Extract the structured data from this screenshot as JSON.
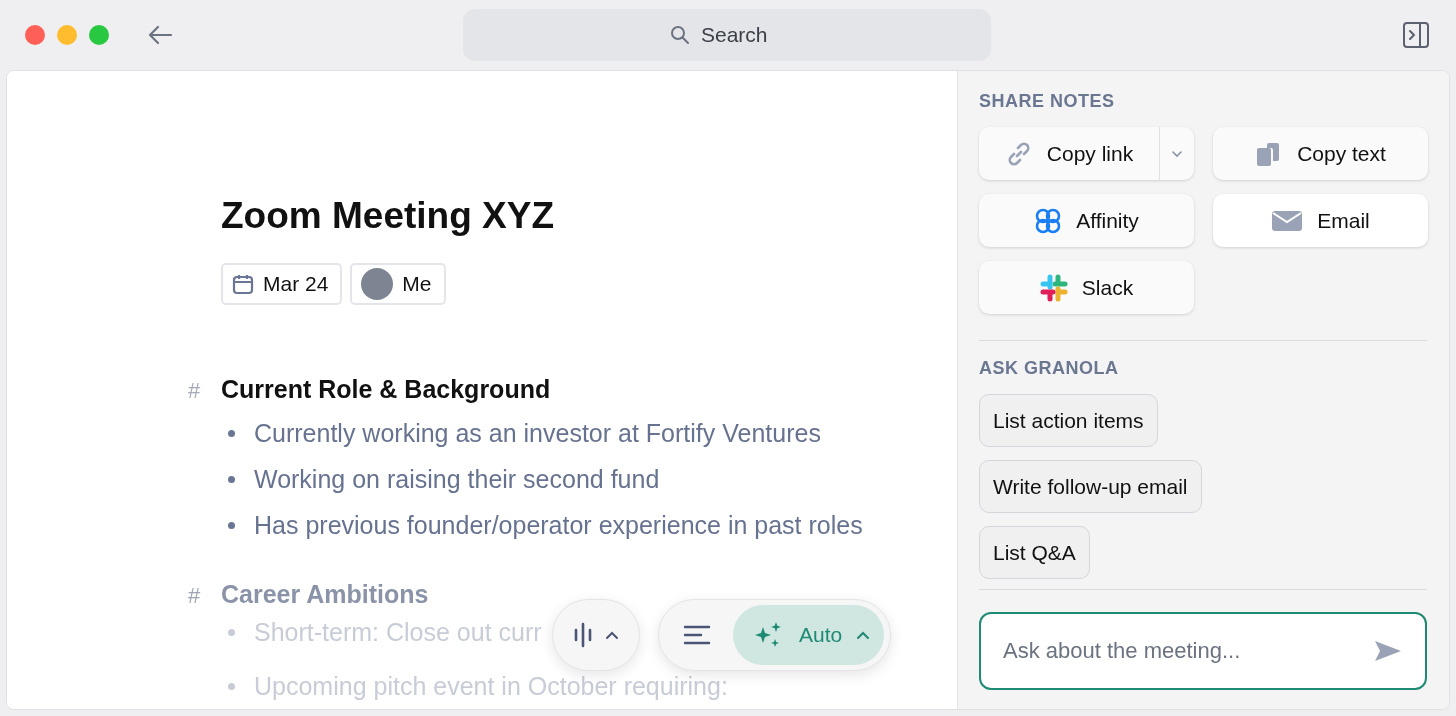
{
  "toolbar": {
    "search": {
      "placeholder": "Search"
    }
  },
  "note": {
    "title": "Zoom Meeting XYZ",
    "date": "Mar 24",
    "attendee": "Me",
    "sections": [
      {
        "heading": "Current Role & Background",
        "marker": "#",
        "faded": false,
        "items": [
          {
            "text": "Currently working as an investor at Fortify Ventures"
          },
          {
            "text": "Working on raising their second fund"
          },
          {
            "text": "Has previous founder/operator experience in past roles"
          }
        ]
      },
      {
        "heading": "Career Ambitions",
        "marker": "#",
        "faded": true,
        "items": [
          {
            "text": "Short-term: Close out curr"
          },
          {
            "text": "Upcoming pitch event in October requiring:"
          }
        ]
      }
    ]
  },
  "controls": {
    "mode": "Auto"
  },
  "panel": {
    "share_title": "SHARE NOTES",
    "share_buttons": [
      {
        "kind": "link",
        "label": "Copy link"
      },
      {
        "kind": "copy",
        "label": "Copy text"
      },
      {
        "kind": "affinity",
        "label": "Affinity"
      },
      {
        "kind": "email",
        "label": "Email"
      },
      {
        "kind": "slack",
        "label": "Slack"
      }
    ],
    "ask_title": "ASK GRANOLA",
    "prompts": [
      "List action items",
      "Write follow-up email",
      "List Q&A"
    ],
    "input": {
      "placeholder": "Ask about the meeting..."
    }
  }
}
